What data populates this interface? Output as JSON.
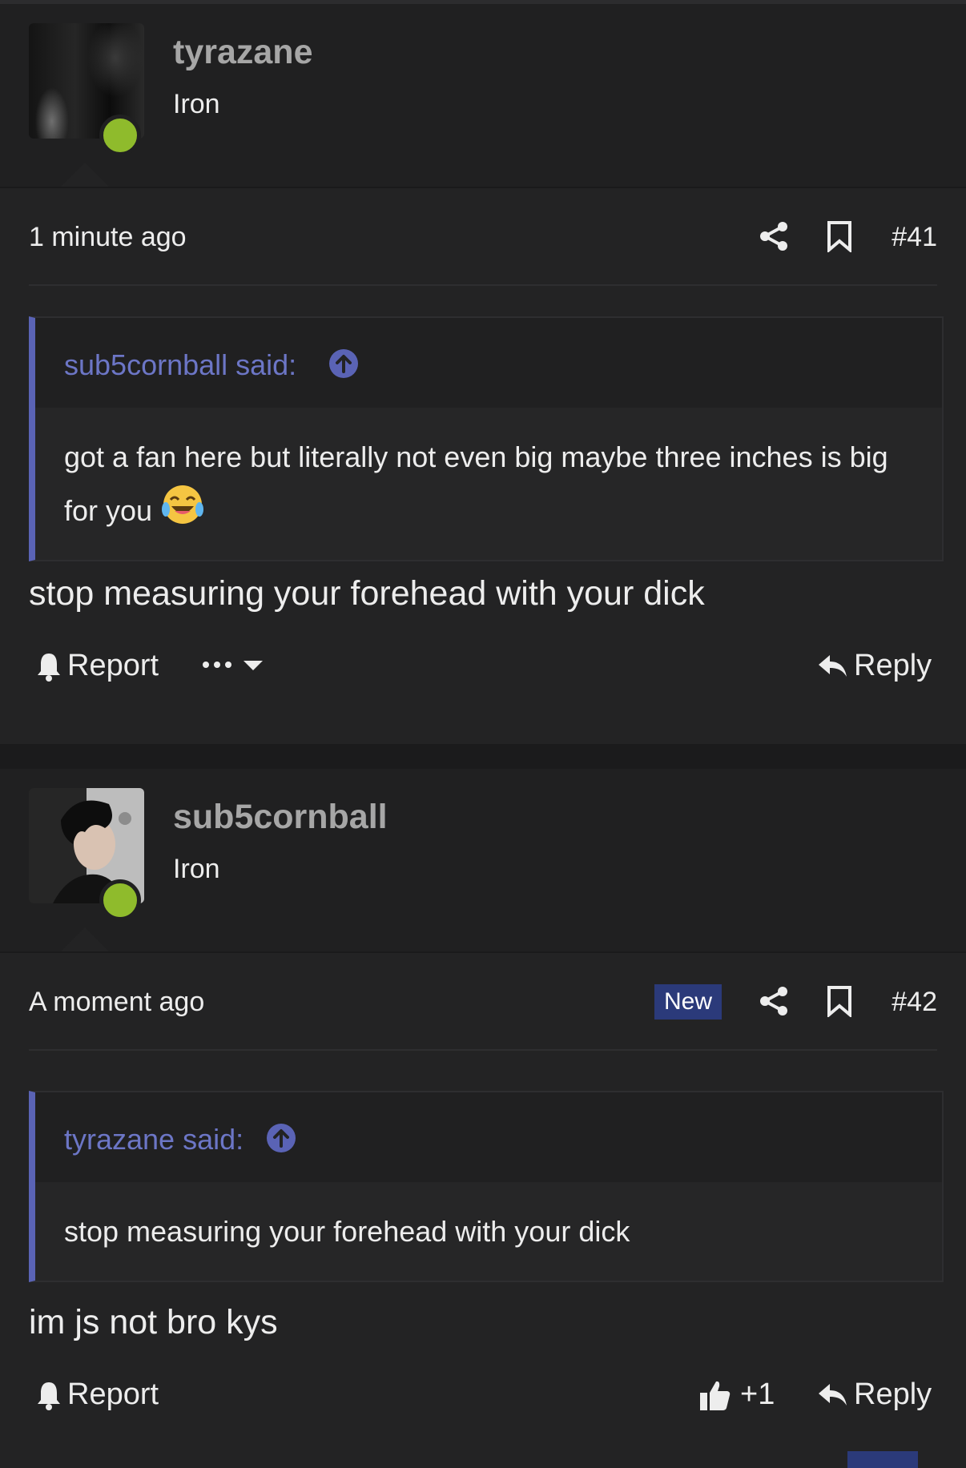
{
  "posts": [
    {
      "username": "tyrazane",
      "rank": "Iron",
      "timestamp": "1 minute ago",
      "post_number": "#41",
      "quote": {
        "author": "sub5cornball said:",
        "text": "got a fan here but literally not even big maybe three inches is big for you"
      },
      "message": "stop measuring your forehead with your dick",
      "actions": {
        "report": "Report",
        "reply": "Reply"
      }
    },
    {
      "username": "sub5cornball",
      "rank": "Iron",
      "timestamp": "A moment ago",
      "badge": "New",
      "post_number": "#42",
      "quote": {
        "author": "tyrazane said:",
        "text": "stop measuring your forehead with your dick"
      },
      "message": "im js not bro kys",
      "actions": {
        "report": "Report",
        "reaction_count": "+1",
        "reply": "Reply"
      }
    }
  ],
  "colors": {
    "accent": "#5a63b5",
    "online": "#8fbb2c",
    "badge": "#2b3a7a"
  }
}
